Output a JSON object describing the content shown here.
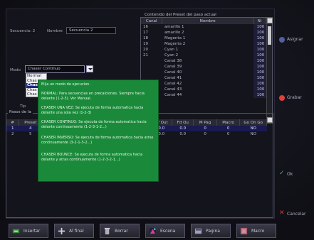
{
  "header": {
    "secuencia_label": "Secuencia: 2",
    "nombre_label": "Nombre",
    "nombre_value": "Secuencia 2",
    "modo_label": "Modo",
    "modo_value": "Chaser Continuo",
    "tipo_label": "Tip"
  },
  "mode_dropdown": {
    "options": [
      "Normal",
      "Chas",
      "Chas",
      "Chas",
      "Chas"
    ],
    "selected_index": 2
  },
  "preset_list": {
    "title": "Contenido del Preset del paso actual",
    "columns": [
      "Canal",
      "Nombre",
      "Ni"
    ],
    "rows": [
      {
        "canal": "16",
        "nombre": "amarillo 1",
        "tipo": "100"
      },
      {
        "canal": "17",
        "nombre": "amarillo 2",
        "tipo": "100"
      },
      {
        "canal": "18",
        "nombre": "Magenta 1",
        "tipo": "100"
      },
      {
        "canal": "19",
        "nombre": "Magenta 2",
        "tipo": "100"
      },
      {
        "canal": "20",
        "nombre": "Cyan 1",
        "tipo": "100"
      },
      {
        "canal": "21",
        "nombre": "Cyan 2",
        "tipo": "100"
      },
      {
        "canal": "",
        "nombre": "Canal 38",
        "tipo": "100"
      },
      {
        "canal": "",
        "nombre": "Canal 39",
        "tipo": "100"
      },
      {
        "canal": "",
        "nombre": "Canal 40",
        "tipo": "100"
      },
      {
        "canal": "",
        "nombre": "Canal 41",
        "tipo": "100"
      },
      {
        "canal": "",
        "nombre": "Canal 42",
        "tipo": "100"
      },
      {
        "canal": "",
        "nombre": "Canal 43",
        "tipo": "100"
      },
      {
        "canal": "",
        "nombre": "Canal 44",
        "tipo": "100"
      }
    ]
  },
  "tooltip": {
    "intro": "Elija un modo de ejecucion.",
    "normal": "NORMAL: Para secuencias en precalciones. Siempre hacia delante (1-2-3). Ver Manual.",
    "una_vez": "CHASER UNA VEZ: Se ejecuta de forma automatica hacia delante una sola vez (1-2-3)",
    "continuo": "CHASER CONTINUO: Se ejecuta de forma automatica hacia delante continuamente (1-2-3-1-2...)",
    "inverso": "CHASER INVERSO: Se ejecuta de forma automatica hacia atras continuamente (3-2-1-3-2...)",
    "bounce": "CHASER BOUNCE: Se ejecuta de forma automatica hacia delante y atras continuamente (1-2-3-2-1...)"
  },
  "steps": {
    "title": "Pasos de la",
    "columns": [
      "#",
      "Preset",
      "",
      "",
      "",
      "",
      "",
      "d In",
      "Df Out",
      "Fd Ou",
      "M Pag",
      "Macro",
      "Go On Go"
    ],
    "rows": [
      {
        "num": "1",
        "preset": "4",
        "c2": "",
        "c3": "",
        "c4": "",
        "c5": "",
        "c6": "",
        "din": "0",
        "dfout": "0.0",
        "fdou": "0.0",
        "mpag": "0",
        "macro": "0",
        "goon": "NO"
      },
      {
        "num": "2",
        "preset": "5",
        "c2": "",
        "c3": "",
        "c4": "",
        "c5": "",
        "c6": "",
        "din": "0",
        "dfout": "0.0",
        "fdou": "0.0",
        "mpag": "0",
        "macro": "0",
        "goon": "NO"
      }
    ]
  },
  "side_buttons": {
    "asignar": "Asignar",
    "grabar": "Grabar",
    "ok": "Ok",
    "cancelar": "Cancelar"
  },
  "toolbar": {
    "insertar": "Insertar",
    "al_final": "Al final",
    "borrar": "Borrar",
    "escena": "Escena",
    "pagina": "Pagina",
    "macro": "Macro"
  },
  "colors": {
    "tooltip_bg": "#1a8a3a",
    "selection": "#1a2a80",
    "ok_icon": "#30c050",
    "cancel_icon": "#e03030",
    "grabar_icon": "#e04040"
  }
}
